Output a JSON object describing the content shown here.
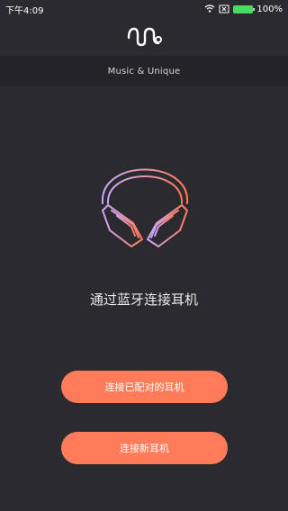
{
  "status_bar": {
    "time": "下午4:09",
    "battery_percent": "100%"
  },
  "header": {
    "tagline": "Music & Unique"
  },
  "main": {
    "title": "通过蓝牙连接耳机",
    "buttons": {
      "paired": "连接已配对的耳机",
      "new": "连接新耳机"
    }
  },
  "colors": {
    "background": "#2b2a2e",
    "band": "#242327",
    "accent": "#ff7b5a",
    "gradient_start": "#c9a7ff",
    "gradient_end": "#ff7b5a"
  },
  "icons": [
    "wifi-icon",
    "close-box-icon",
    "battery-icon",
    "logo-icon",
    "headphones-icon"
  ]
}
